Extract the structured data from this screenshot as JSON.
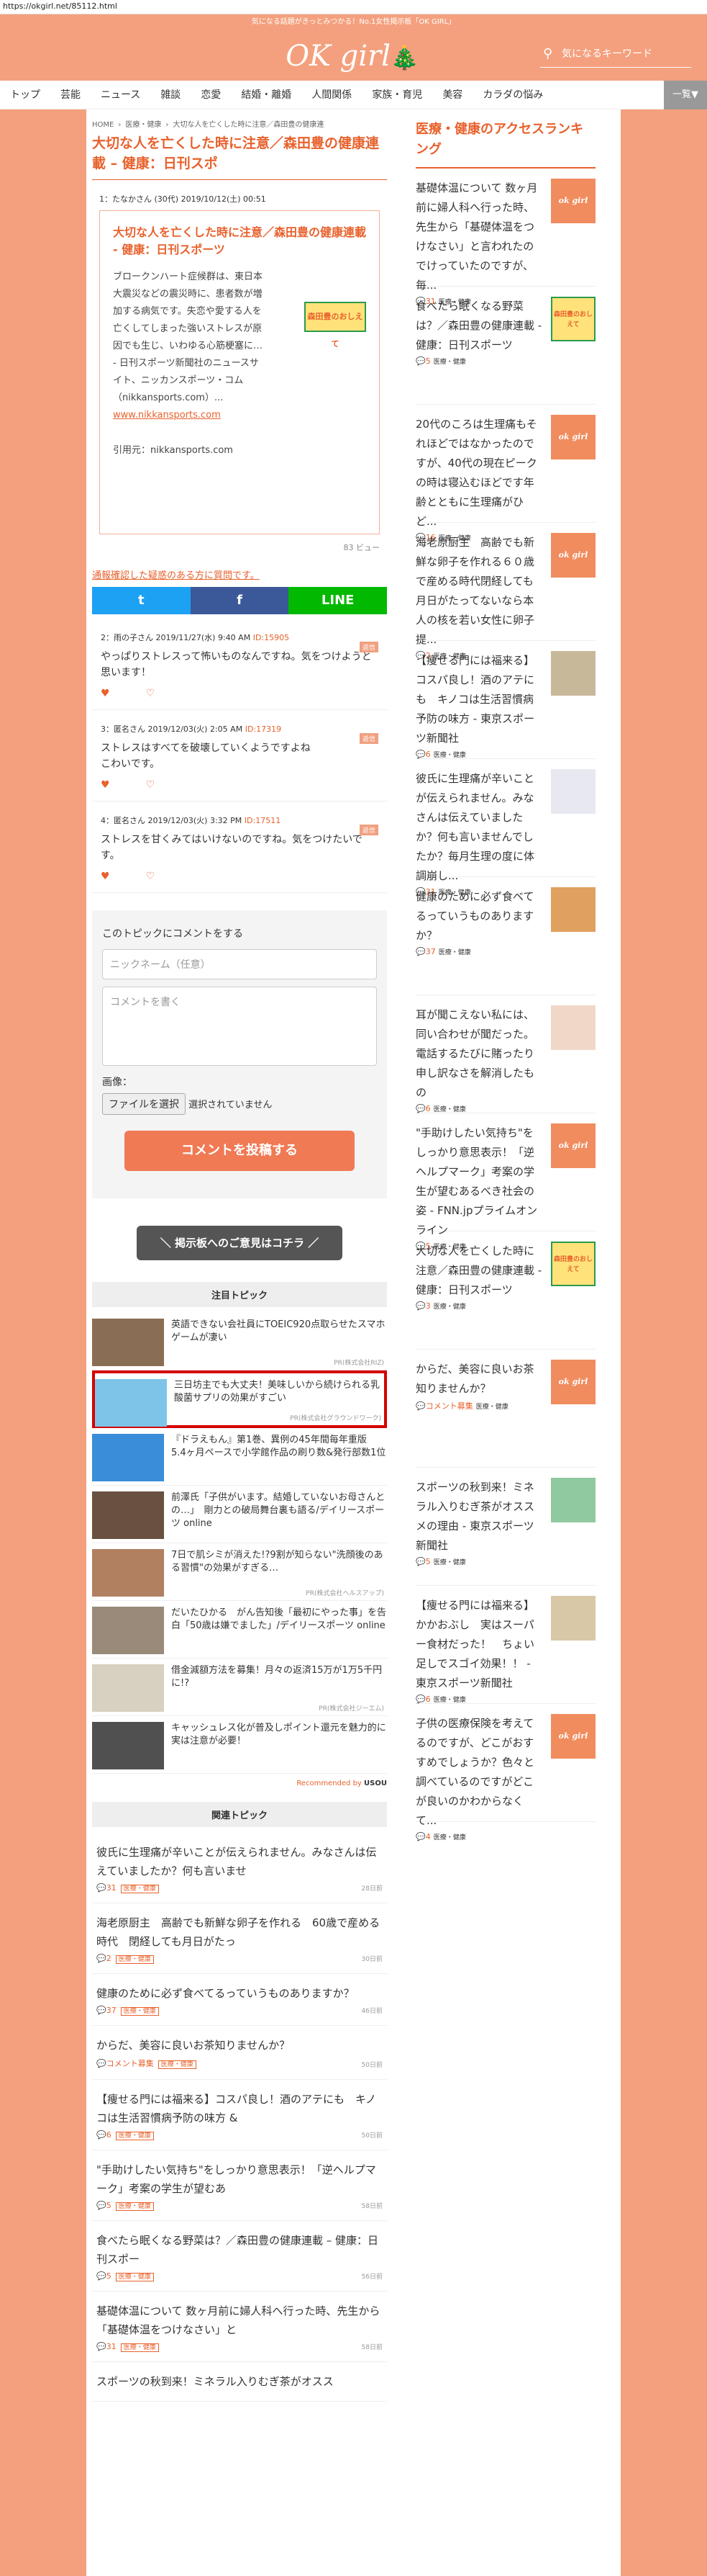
{
  "url": "https://okgirl.net/85112.html",
  "topband": "気になる話題がきっとみつかる！No.1女性掲示板「OK GIRL」",
  "logo": "OK girl",
  "search": {
    "placeholder": "気になるキーワード"
  },
  "nav": {
    "items": [
      "トップ",
      "芸能",
      "ニュース",
      "雑談",
      "恋愛",
      "結婚・離婚",
      "人間関係",
      "家族・育児",
      "美容",
      "カラダの悩み"
    ],
    "more": "一覧▼"
  },
  "breadcrumbs": [
    "HOME",
    "医療・健康",
    "大切な人を亡くした時に注意／森田豊の健康連"
  ],
  "article": {
    "title": "大切な人を亡くした時に注意／森田豊の健康連載 – 健康：日刊スポ",
    "meta": "1：たなかさん (30代) 2019/10/12(土) 00:51",
    "box_title": "大切な人を亡くした時に注意／森田豊の健康連載 - 健康：日刊スポーツ",
    "thumb": "森田豊のおしえて",
    "body": "ブロークンハート症候群は、東日本大震災などの震災時に、患者数が増加する病気です。失恋や愛する人を亡くしてしまった強いストレスが原因でも生じ、いわゆる心筋梗塞に… - 日刊スポーツ新聞社のニュースサイト、ニッカンスポーツ・コム（nikkansports.com）...",
    "link": "www.nikkansports.com",
    "cite": "引用元：nikkansports.com",
    "views": "83 ビュー"
  },
  "report": "通報確認した疑惑のある方に質問です。",
  "share": {
    "twitter": "t",
    "facebook": "f",
    "line": "LINE"
  },
  "comments": [
    {
      "head": "2：雨の子さん 2019/11/27(水) 9:40 AM",
      "id": "ID:15905",
      "ret": "返信",
      "body": "やっぱりストレスって怖いものなんですね。気をつけようと思います！"
    },
    {
      "head": "3：匿名さん 2019/12/03(火) 2:05 AM",
      "id": "ID:17319",
      "ret": "返信",
      "body": "ストレスはすべてを破壊していくようですよね\nこわいです。"
    },
    {
      "head": "4：匿名さん 2019/12/03(火) 3:32 PM",
      "id": "ID:17511",
      "ret": "返信",
      "body": "ストレスを甘くみてはいけないのですね。気をつけたいです。"
    }
  ],
  "form": {
    "label": "このトピックにコメントをする",
    "nick": "ニックネーム（任意）",
    "comment": "コメントを書く",
    "image": "画像：",
    "file": "ファイルを選択",
    "nofile": "選択されていません",
    "post": "コメントを投稿する"
  },
  "opinion": "＼ 掲示板へのご意見はコチラ ／",
  "featured": {
    "title": "注目トピック",
    "items": [
      {
        "text": "英語できない会社員にTOEIC920点取らせたスマホゲームが凄い",
        "pr": "PR(株式会社RIZ)",
        "color": "#8a6d55"
      },
      {
        "text": "三日坊主でも大丈夫！美味しいから続けられる乳酸菌サプリの効果がすごい",
        "pr": "PR(株式会社グラウンドワーク)",
        "color": "#7ec4e8"
      },
      {
        "text": "『ドラえもん』第1巻、異例の45年間毎年重版　5.4ヶ月ペースで小学館作品の刷り数&発行部数1位",
        "pr": "",
        "color": "#3a8dd8"
      },
      {
        "text": "前澤氏「子供がいます。結婚していないお母さんとの…」　剛力との破局舞台裏も語る/デイリースポーツ online",
        "pr": "",
        "color": "#6a5040"
      },
      {
        "text": "7日で肌シミが消えた!?9割が知らない\"洗顔後のある習慣\"の効果がすぎる…",
        "pr": "PR(株式会社ヘルスアップ)",
        "color": "#b08060"
      },
      {
        "text": "だいたひかる　がん告知後「最初にやった事」を告白「50歳は嫌でました」/デイリースポーツ online",
        "pr": "",
        "color": "#9a8a7a"
      },
      {
        "text": "借金減額方法を募集！月々の返済15万が1万5千円に!?",
        "pr": "PR(株式会社ジーエム)",
        "color": "#d8d0c0"
      },
      {
        "text": "キャッシュレス化が普及しポイント還元を魅力的に実は注意が必要！",
        "pr": "",
        "color": "#505050"
      }
    ],
    "byline": "Recommended by",
    "brand": "USOU"
  },
  "related": {
    "title": "関連トピック",
    "items": [
      {
        "t": "彼氏に生理痛が辛いことが伝えられません。みなさんは伝えていましたか？何も言いませ",
        "c": "31",
        "tag": "医療・健康",
        "d": "28日前"
      },
      {
        "t": "海老原厨主　高齢でも新鮮な卵子を作れる　60歳で産める時代　閉経しても月日がたっ",
        "c": "2",
        "tag": "医療・健康",
        "d": "30日前"
      },
      {
        "t": "健康のために必ず食べてるっていうものありますか？",
        "c": "37",
        "tag": "医療・健康",
        "d": "46日前"
      },
      {
        "t": "からだ、美容に良いお茶知りませんか？",
        "c": "コメント募集",
        "tag": "医療・健康",
        "d": "50日前"
      },
      {
        "t": "【痩せる門には福来る】コスパ良し！酒のアテにも　キノコは生活習慣病予防の味方 &",
        "c": "6",
        "tag": "医療・健康",
        "d": "50日前"
      },
      {
        "t": "\"手助けしたい気持ち\"をしっかり意思表示！「逆ヘルプマーク」考案の学生が望むあ",
        "c": "5",
        "tag": "医療・健康",
        "d": "58日前"
      },
      {
        "t": "食べたら眠くなる野菜は？／森田豊の健康連載 – 健康：日刊スポー",
        "c": "5",
        "tag": "医療・健康",
        "d": "56日前"
      },
      {
        "t": "基礎体温について 数ヶ月前に婦人科へ行った時、先生から「基礎体温をつけなさい」と",
        "c": "31",
        "tag": "医療・健康",
        "d": "58日前"
      },
      {
        "t": "スポーツの秋到来！ミネラル入りむぎ茶がオスス",
        "c": "",
        "tag": "",
        "d": ""
      }
    ]
  },
  "ranking": {
    "title": "医療・健康のアクセスランキング",
    "items": [
      {
        "t": "基礎体温について 数ヶ月前に婦人科へ行った時、先生から「基礎体温をつけなさい」と言われたのでけっていたのですが、毎...",
        "c": "31",
        "icon": "ok",
        "color": "#f08c5e"
      },
      {
        "t": "食べたら眠くなる野菜は？／森田豊の健康連載 - 健康：日刊スポーツ",
        "c": "5",
        "icon": "森田豊のおしえて",
        "color": "#ffe37a"
      },
      {
        "t": "20代のころは生理痛もそれほどではなかったのですが、40代の現在ピークの時は寝込むほどです年齢とともに生理痛がひど...",
        "c": "16",
        "icon": "ok",
        "color": "#f08c5e"
      },
      {
        "t": "海老原厨主　高齢でも新鮮な卵子を作れる６０歳で産める時代閉経しても月日がたってないなら本人の核を若い女性に卵子提...",
        "c": "2",
        "icon": "ok",
        "color": "#f08c5e"
      },
      {
        "t": "【痩せる門には福来る】コスパ良し！酒のアテにも　キノコは生活習慣病予防の味方 - 東京スポーツ新聞社",
        "c": "6",
        "icon": "photo",
        "color": "#c8b89a"
      },
      {
        "t": "彼氏に生理痛が辛いことが伝えられません。みなさんは伝えていましたか？何も言いませんでしたか？毎月生理の度に体調崩し...",
        "c": "31",
        "icon": "photo",
        "color": "#e8e8f0"
      },
      {
        "t": "健康のために必ず食べてるっていうものありますか？",
        "c": "37",
        "icon": "photo",
        "color": "#e0a060"
      },
      {
        "t": "耳が聞こえない私には、同い合わせが聞だった。電話するたびに賭ったり申し訳なさを解消したもの",
        "c": "6",
        "icon": "photo",
        "color": "#f0d8c8"
      },
      {
        "t": "\"手助けしたい気持ち\"をしっかり意思表示！「逆ヘルプマーク」考案の学生が望むあるべき社会の姿 - FNN.jpプライムオンライン",
        "c": "5",
        "icon": "ok",
        "color": "#f08c5e"
      },
      {
        "t": "大切な人を亡くした時に注意／森田豊の健康連載 - 健康：日刊スポーツ",
        "c": "3",
        "icon": "森田豊のおしえて",
        "color": "#ffe37a"
      },
      {
        "t": "からだ、美容に良いお茶知りませんか？",
        "c": "コメント募集",
        "icon": "ok",
        "color": "#f08c5e"
      },
      {
        "t": "スポーツの秋到来！ミネラル入りむぎ茶がオススメの理由 - 東京スポーツ新聞社",
        "c": "5",
        "icon": "photo",
        "color": "#90c8a0"
      },
      {
        "t": "【痩せる門には福来る】かかおぶし　実はスーパー食材だった！　ちょい足しでスゴイ効果！！ - 東京スポーツ新聞社",
        "c": "6",
        "icon": "photo",
        "color": "#d8c8a8"
      },
      {
        "t": "子供の医療保険を考えてるのですが、どこがおすすめでしょうか？色々と調べているのですがどこが良いのかわからなくて...",
        "c": "4",
        "icon": "ok",
        "color": "#f08c5e"
      }
    ],
    "tag": "医療・健康"
  }
}
